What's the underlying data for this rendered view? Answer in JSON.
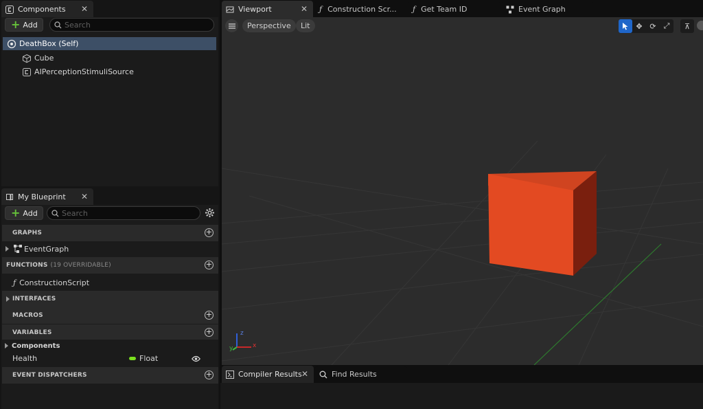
{
  "components_panel": {
    "tab_label": "Components",
    "add_label": "Add",
    "search_placeholder": "Search",
    "tree": [
      {
        "label": "DeathBox (Self)",
        "selected": true
      },
      {
        "label": "Cube"
      },
      {
        "label": "AIPerceptionStimuliSource"
      }
    ]
  },
  "blueprint_panel": {
    "tab_label": "My Blueprint",
    "add_label": "Add",
    "search_placeholder": "Search",
    "sections": {
      "graphs": "GRAPHS",
      "functions": "FUNCTIONS",
      "functions_sub": "(19 OVERRIDABLE)",
      "interfaces": "INTERFACES",
      "macros": "MACROS",
      "variables": "VARIABLES",
      "event_dispatchers": "EVENT DISPATCHERS"
    },
    "graph_items": [
      "EventGraph"
    ],
    "function_items": [
      "ConstructionScript"
    ],
    "variable_category": "Components",
    "variables": [
      {
        "name": "Health",
        "type": "Float",
        "type_color": "#7be01e"
      }
    ]
  },
  "main_tabs": [
    {
      "label": "Viewport",
      "active": true
    },
    {
      "label": "Construction Scr..."
    },
    {
      "label": "Get Team ID"
    },
    {
      "label": "Event Graph"
    }
  ],
  "viewport": {
    "view_mode": "Perspective",
    "lighting": "Lit",
    "cube_color": "#e34a22",
    "axis_labels": {
      "x": "x",
      "y": "y",
      "z": "z"
    }
  },
  "bottom_tabs": [
    {
      "label": "Compiler Results"
    },
    {
      "label": "Find Results"
    }
  ],
  "colors": {
    "selection": "#3d4f66",
    "accent_blue": "#1f66c9",
    "add_green": "#66c23a"
  }
}
